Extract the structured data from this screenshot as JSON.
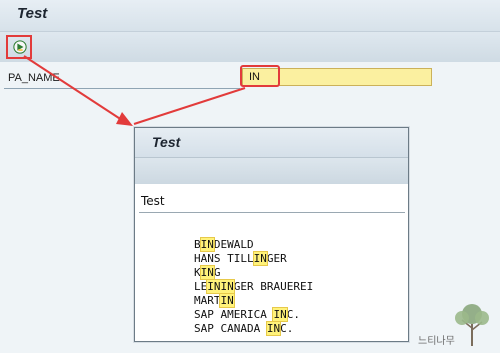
{
  "window": {
    "title": "Test",
    "toolbar": {
      "execute_icon": "execute-icon"
    }
  },
  "selection_screen": {
    "field_label": "PA_NAME",
    "field_value": "IN"
  },
  "popup": {
    "title": "Test",
    "header_text": "Test",
    "rows": [
      {
        "pre": "B",
        "match": "IN",
        "post": "DEWALD"
      },
      {
        "pre": "HANS TILL",
        "match": "IN",
        "post": "GER"
      },
      {
        "pre": "K",
        "match": "IN",
        "post": "G"
      },
      {
        "pre": "LE",
        "match": "ININ",
        "post": "GER BRAUEREI"
      },
      {
        "pre": "MART",
        "match": "IN",
        "post": ""
      },
      {
        "pre": "SAP AMERICA ",
        "match": "IN",
        "post": "C."
      },
      {
        "pre": "SAP CANADA ",
        "match": "IN",
        "post": "C."
      }
    ]
  },
  "watermark": {
    "text": "느티나무",
    "icon": "tree-logo-icon"
  },
  "colors": {
    "highlight_red": "#e23b3b",
    "field_yellow": "#fbf0a0",
    "match_yellow": "#fff27a"
  }
}
